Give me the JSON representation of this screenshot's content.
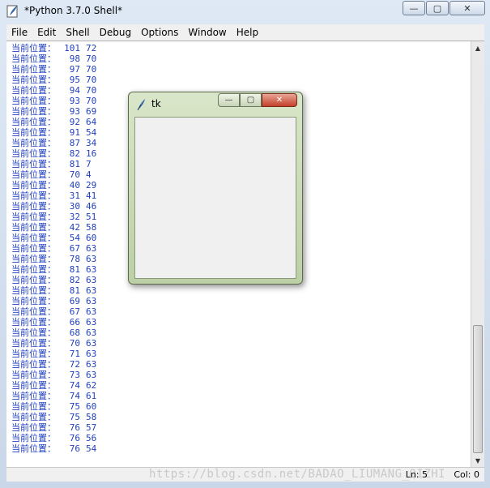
{
  "window": {
    "title": "*Python 3.7.0 Shell*"
  },
  "menu": [
    "File",
    "Edit",
    "Shell",
    "Debug",
    "Options",
    "Window",
    "Help"
  ],
  "output_label": "当前位置：",
  "output_lines": [
    {
      "x": "101",
      "y": "72"
    },
    {
      "x": "98",
      "y": "70"
    },
    {
      "x": "97",
      "y": "70"
    },
    {
      "x": "95",
      "y": "70"
    },
    {
      "x": "94",
      "y": "70"
    },
    {
      "x": "93",
      "y": "70"
    },
    {
      "x": "93",
      "y": "69"
    },
    {
      "x": "92",
      "y": "64"
    },
    {
      "x": "91",
      "y": "54"
    },
    {
      "x": "87",
      "y": "34"
    },
    {
      "x": "82",
      "y": "16"
    },
    {
      "x": "81",
      "y": "7"
    },
    {
      "x": "70",
      "y": "4"
    },
    {
      "x": "40",
      "y": "29"
    },
    {
      "x": "31",
      "y": "41"
    },
    {
      "x": "30",
      "y": "46"
    },
    {
      "x": "32",
      "y": "51"
    },
    {
      "x": "42",
      "y": "58"
    },
    {
      "x": "54",
      "y": "60"
    },
    {
      "x": "67",
      "y": "63"
    },
    {
      "x": "78",
      "y": "63"
    },
    {
      "x": "81",
      "y": "63"
    },
    {
      "x": "82",
      "y": "63"
    },
    {
      "x": "81",
      "y": "63"
    },
    {
      "x": "69",
      "y": "63"
    },
    {
      "x": "67",
      "y": "63"
    },
    {
      "x": "66",
      "y": "63"
    },
    {
      "x": "68",
      "y": "63"
    },
    {
      "x": "70",
      "y": "63"
    },
    {
      "x": "71",
      "y": "63"
    },
    {
      "x": "72",
      "y": "63"
    },
    {
      "x": "73",
      "y": "63"
    },
    {
      "x": "74",
      "y": "62"
    },
    {
      "x": "74",
      "y": "61"
    },
    {
      "x": "75",
      "y": "60"
    },
    {
      "x": "75",
      "y": "58"
    },
    {
      "x": "76",
      "y": "57"
    },
    {
      "x": "76",
      "y": "56"
    },
    {
      "x": "76",
      "y": "54"
    }
  ],
  "status": {
    "line": "Ln: 5",
    "col": "Col: 0",
    "watermark": "https://blog.csdn.net/BADAO_LIUMANG_QIZHI"
  },
  "tk_window": {
    "title": "tk"
  },
  "icons": {
    "app": "python-feather-icon",
    "tk": "tk-feather-icon",
    "minimize": "minimize-icon",
    "maximize": "maximize-icon",
    "close": "close-icon"
  }
}
